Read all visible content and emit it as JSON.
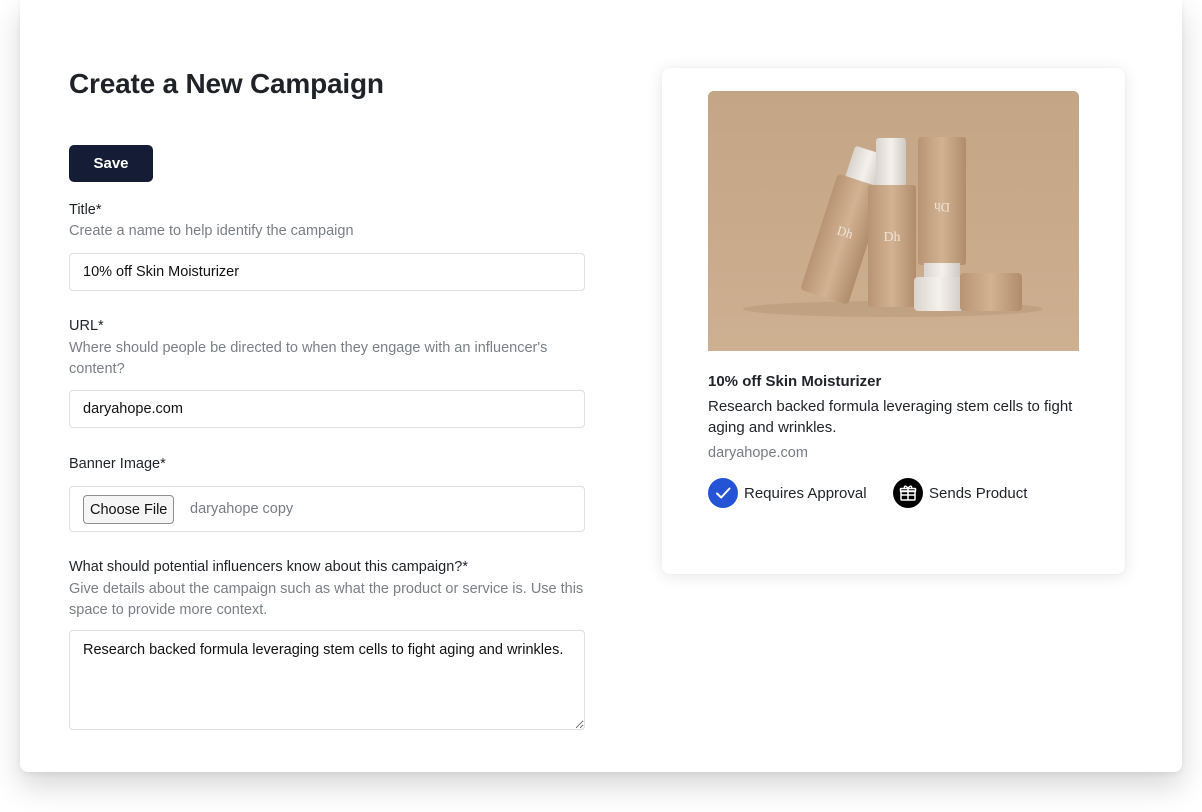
{
  "page": {
    "title": "Create a New Campaign",
    "save_label": "Save"
  },
  "form": {
    "title": {
      "label": "Title*",
      "help": "Create a name to help identify the campaign",
      "value": "10% off Skin Moisturizer"
    },
    "url": {
      "label": "URL*",
      "help": "Where should people be directed to when they engage with an influencer's content?",
      "value": "daryahope.com"
    },
    "banner": {
      "label": "Banner Image*",
      "button_label": "Choose File",
      "file_name": "daryahope copy"
    },
    "details": {
      "label": "What should potential influencers know about this campaign?*",
      "help": "Give details about the campaign such as what the product or service is. Use this space to provide more context.",
      "value": "Research backed formula leveraging stem cells to fight aging and wrinkles."
    }
  },
  "preview": {
    "title": "10% off Skin Moisturizer",
    "description": "Research backed formula leveraging stem cells to fight aging and wrinkles.",
    "url": "daryahope.com",
    "image_logo": "Dh",
    "badges": [
      {
        "label": "Requires Approval",
        "icon": "check-circle-icon",
        "color": "#2453d6"
      },
      {
        "label": "Sends Product",
        "icon": "gift-icon",
        "color": "#000000"
      }
    ]
  },
  "colors": {
    "accent": "#141c36",
    "banner_bg": "#c7a888",
    "approval_blue": "#2453d6"
  }
}
